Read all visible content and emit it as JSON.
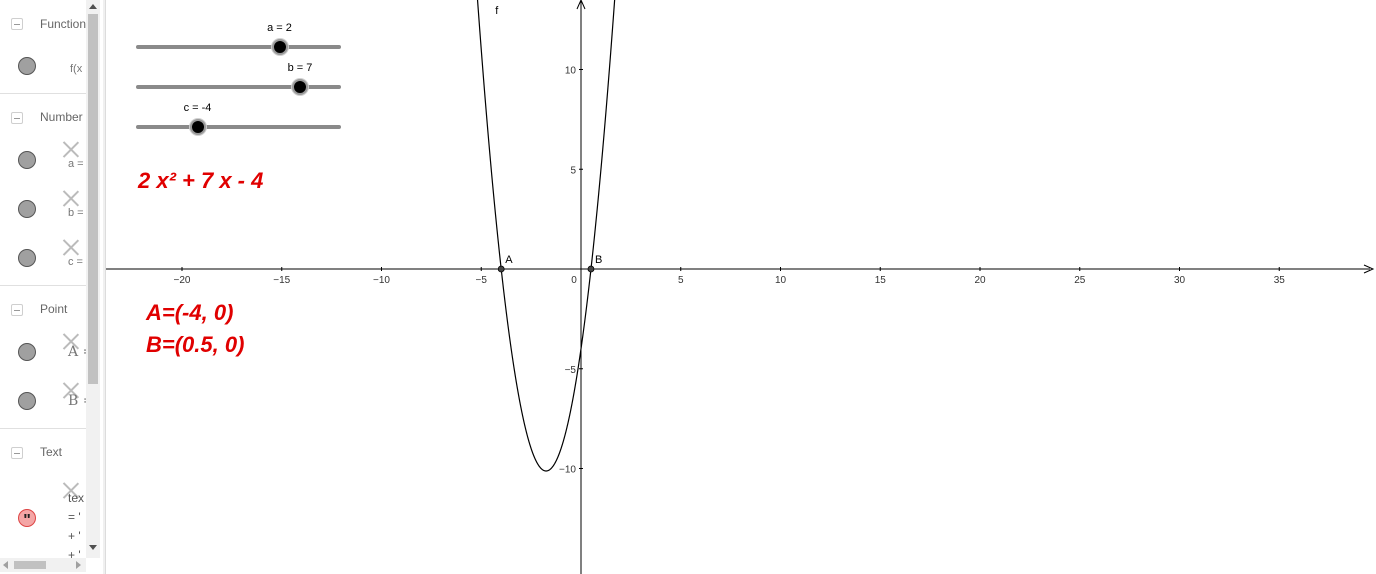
{
  "algebra": {
    "groups": {
      "function": "Function",
      "number": "Number",
      "point": "Point",
      "text": "Text"
    },
    "rows": {
      "f": "f(x",
      "a": "a =",
      "b": "b =",
      "c": "c =",
      "A": "A =",
      "B": "B ="
    },
    "text_item": {
      "line1": "tex",
      "line2": "= '",
      "line3": "+ '",
      "line4": "+ '"
    }
  },
  "sliders": {
    "a": {
      "label": "a = 2",
      "value": 2,
      "min": -5,
      "max": 5
    },
    "b": {
      "label": "b = 7",
      "value": 7,
      "min": -5,
      "max": 10
    },
    "c": {
      "label": "c = -4",
      "value": -4,
      "min": -10,
      "max": 10
    }
  },
  "texts": {
    "equation": "2 x² + 7 x - 4",
    "pointA": "A=(-4, 0)",
    "pointB": "B=(0.5, 0)"
  },
  "colors": {
    "text_accent": "#e00000",
    "curve": "#000000",
    "axis": "#000000"
  },
  "chart_data": {
    "type": "line",
    "function_label": "f",
    "coefficients": {
      "a": 2,
      "b": 7,
      "c": -4
    },
    "points": [
      {
        "name": "A",
        "x": -4,
        "y": 0
      },
      {
        "name": "B",
        "x": 0.5,
        "y": 0
      }
    ],
    "xlim": [
      -23,
      40
    ],
    "ylim": [
      -15,
      13.5
    ],
    "x_ticks": [
      "−20",
      "−15",
      "−10",
      "−5",
      "0",
      "5",
      "10",
      "15",
      "20",
      "25",
      "30",
      "35"
    ],
    "y_ticks": [
      "10",
      "5",
      "−5",
      "−10"
    ],
    "grid": false
  }
}
